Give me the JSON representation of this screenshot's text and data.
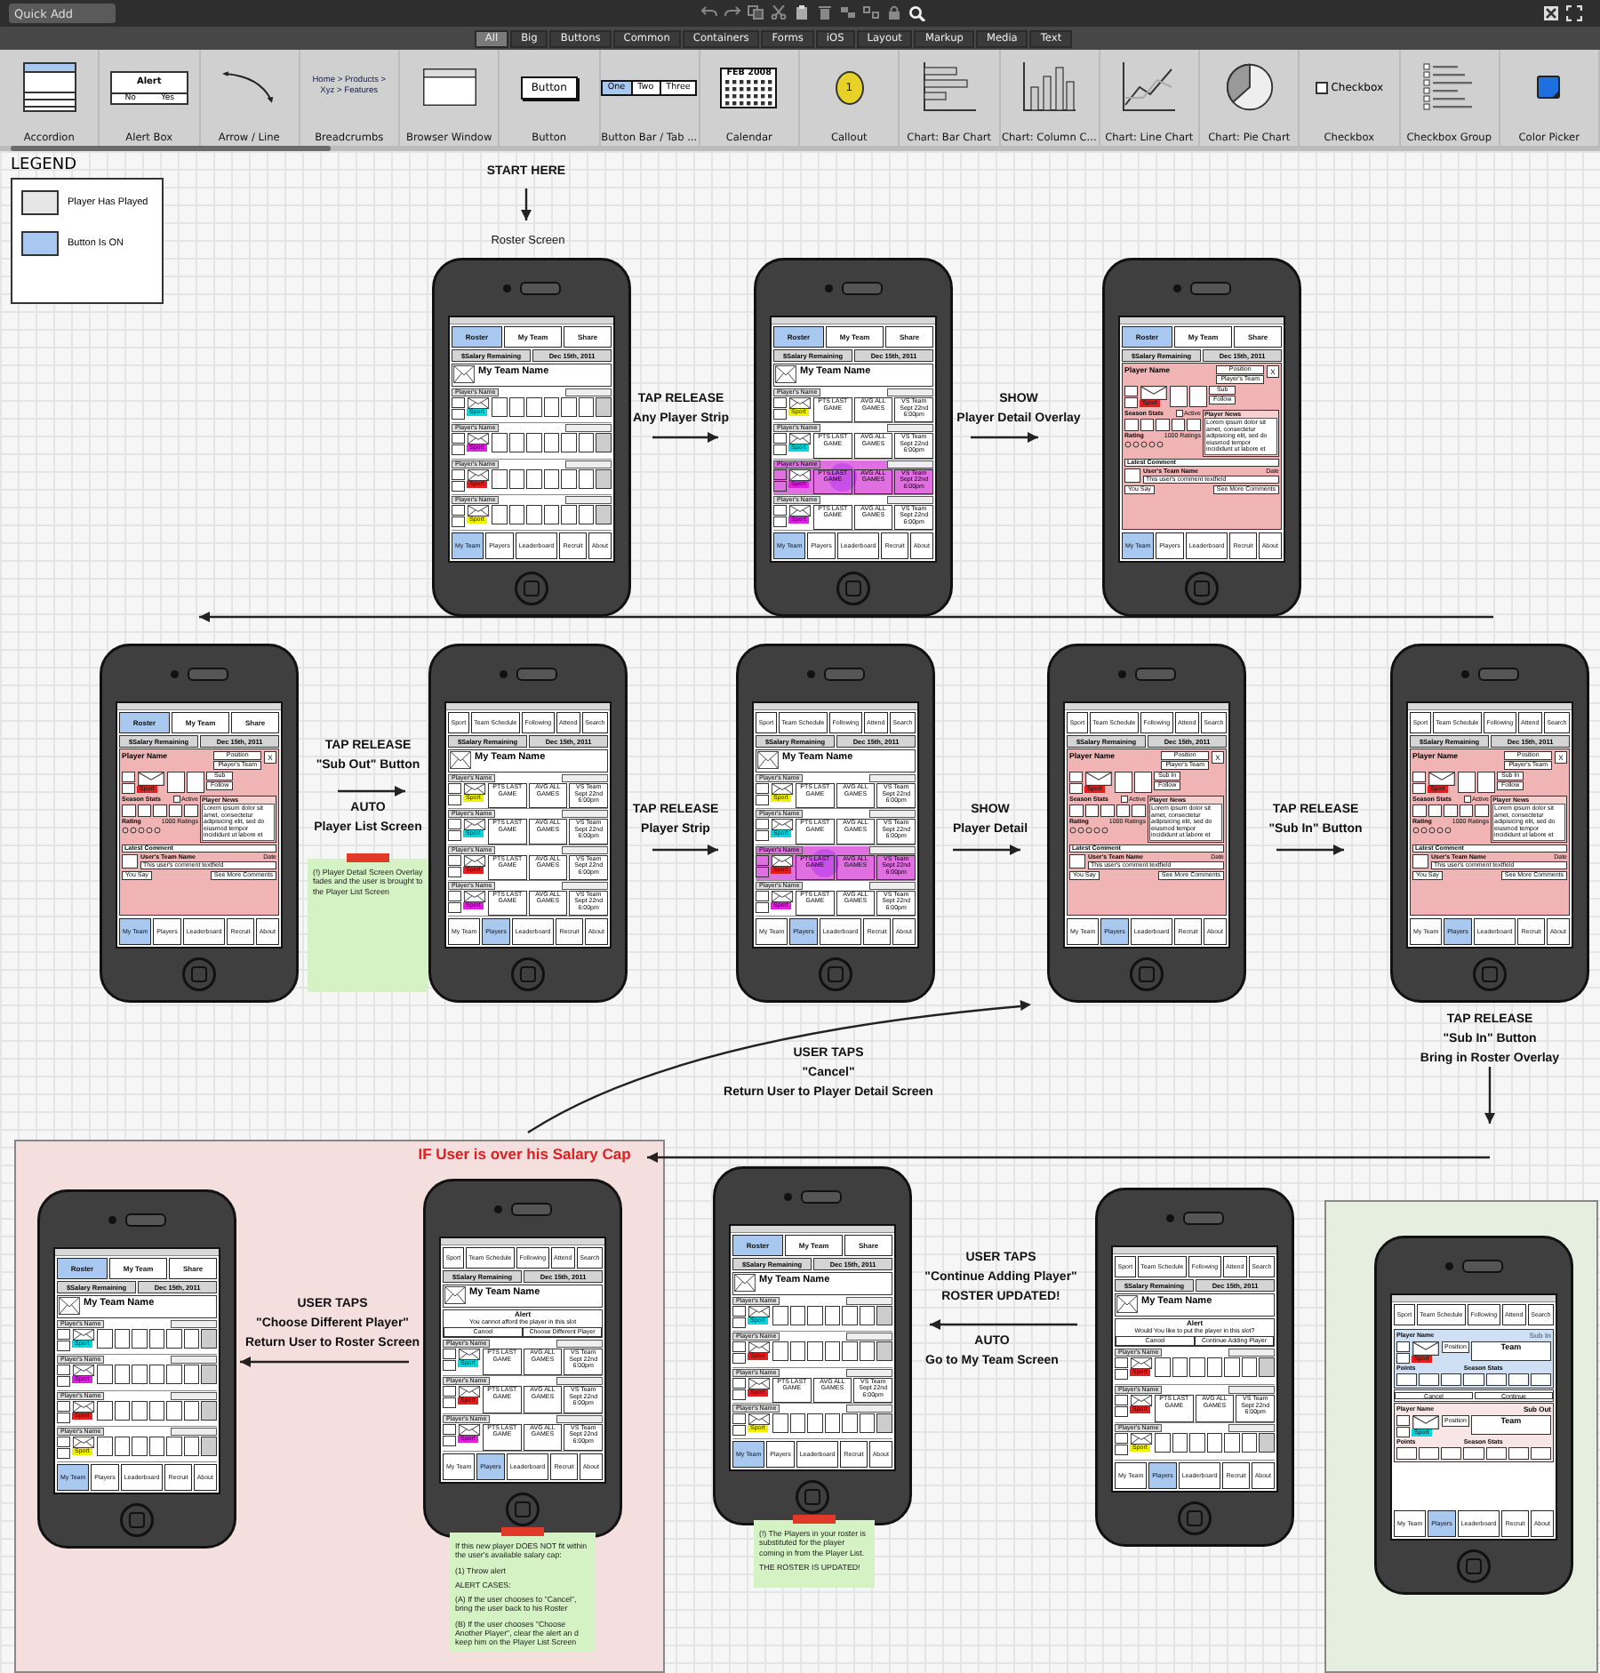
{
  "toolbar": {
    "quick_add": {
      "placeholder": "Quick Add"
    },
    "filters": [
      {
        "label": "All",
        "selected": true
      },
      {
        "label": "Big",
        "selected": false
      },
      {
        "label": "Buttons",
        "selected": false
      },
      {
        "label": "Common",
        "selected": false
      },
      {
        "label": "Containers",
        "selected": false
      },
      {
        "label": "Forms",
        "selected": false
      },
      {
        "label": "iOS",
        "selected": false
      },
      {
        "label": "Layout",
        "selected": false
      },
      {
        "label": "Markup",
        "selected": false
      },
      {
        "label": "Media",
        "selected": false
      },
      {
        "label": "Text",
        "selected": false
      }
    ],
    "components": [
      {
        "kind": "accordion",
        "label": "Accordion"
      },
      {
        "kind": "alertbox",
        "label": "Alert Box",
        "preview": [
          "Alert",
          "No",
          "Yes"
        ]
      },
      {
        "kind": "arrow",
        "label": "Arrow / Line"
      },
      {
        "kind": "breadcrumbs",
        "label": "Breadcrumbs",
        "preview": [
          "Home > Products > Xyz > Features"
        ]
      },
      {
        "kind": "browser",
        "label": "Browser Window"
      },
      {
        "kind": "button",
        "label": "Button",
        "preview": [
          "Button"
        ]
      },
      {
        "kind": "buttonbar",
        "label": "Button Bar / Tab ...",
        "preview": [
          "One",
          "Two",
          "Three"
        ]
      },
      {
        "kind": "calendar",
        "label": "Calendar",
        "preview": [
          "FEB 2008"
        ]
      },
      {
        "kind": "callout",
        "label": "Callout",
        "preview": [
          "1"
        ]
      },
      {
        "kind": "barchart",
        "label": "Chart: Bar Chart"
      },
      {
        "kind": "columnchart",
        "label": "Chart: Column C..."
      },
      {
        "kind": "linechart",
        "label": "Chart: Line Chart"
      },
      {
        "kind": "piechart",
        "label": "Chart: Pie Chart"
      },
      {
        "kind": "checkbox",
        "label": "Checkbox",
        "preview": [
          "Checkbox"
        ]
      },
      {
        "kind": "checkboxgroup",
        "label": "Checkbox Group"
      },
      {
        "kind": "colorpicker",
        "label": "Color Picker"
      }
    ]
  },
  "legend": {
    "title": "LEGEND",
    "items": [
      {
        "label": "Player Has Played",
        "color": "#e6e6e6"
      },
      {
        "label": "Button Is ON",
        "color": "#a8c8f0"
      }
    ]
  },
  "annotations": [
    {
      "kind": "plain",
      "lines": [
        "START HERE"
      ]
    },
    {
      "kind": "small",
      "lines": [
        "Roster Screen"
      ]
    },
    {
      "kind": "plain",
      "lines": [
        "TAP RELEASE",
        "Any Player Strip"
      ]
    },
    {
      "kind": "plain",
      "lines": [
        "SHOW",
        "Player Detail Overlay"
      ]
    },
    {
      "kind": "plain",
      "lines": [
        "TAP RELEASE",
        "\"Sub Out\" Button"
      ]
    },
    {
      "kind": "plain",
      "lines": [
        "AUTO",
        "Player List Screen"
      ]
    },
    {
      "kind": "plain",
      "lines": [
        "TAP RELEASE",
        "Player Strip"
      ]
    },
    {
      "kind": "plain",
      "lines": [
        "SHOW",
        "Player Detail"
      ]
    },
    {
      "kind": "plain",
      "lines": [
        "TAP RELEASE",
        "\"Sub In\" Button"
      ]
    },
    {
      "kind": "plain",
      "lines": [
        "TAP RELEASE",
        "\"Sub In\" Button",
        "Bring in Roster Overlay"
      ]
    },
    {
      "kind": "plain",
      "lines": [
        "USER TAPS",
        "\"Cancel\"",
        "Return User to Player Detail Screen"
      ]
    },
    {
      "kind": "warning",
      "lines": [
        "IF User is over his Salary Cap"
      ]
    },
    {
      "kind": "plain",
      "lines": [
        "USER TAPS",
        "\"Choose Different Player\"",
        "Return User to Roster Screen"
      ]
    },
    {
      "kind": "plain",
      "lines": [
        "USER TAPS",
        "\"Continue Adding Player\"",
        "ROSTER UPDATED!"
      ]
    },
    {
      "kind": "plain",
      "lines": [
        "AUTO",
        "Go to My Team Screen"
      ]
    }
  ],
  "phones": [
    {
      "kind": "roster",
      "top_tabs": [
        {
          "label": "Roster",
          "selected": true
        },
        {
          "label": "My Team",
          "selected": false
        },
        {
          "label": "Share",
          "selected": false
        }
      ],
      "salary": "$Salary Remaining",
      "date": "Dec 15th, 2011",
      "team_name": "My Team Name",
      "strips": [
        {
          "name": "Player's Name",
          "tag": "Sport",
          "color": "#00d8e0",
          "selected": false
        },
        {
          "name": "Player's Name",
          "tag": "Sport",
          "color": "#e020e0",
          "selected": false
        },
        {
          "name": "Player's Name",
          "tag": "Sport",
          "color": "#e02020",
          "selected": false
        },
        {
          "name": "Player's Name",
          "tag": "Sport",
          "color": "#f0f000",
          "selected": false
        }
      ],
      "bottom_tabs": [
        {
          "label": "My Team",
          "selected": true
        },
        {
          "label": "Players",
          "selected": false
        },
        {
          "label": "Leaderboard",
          "selected": false
        },
        {
          "label": "Recruit",
          "selected": false
        },
        {
          "label": "About",
          "selected": false
        }
      ]
    },
    {
      "kind": "roster",
      "top_tabs": [
        {
          "label": "Roster",
          "selected": true
        },
        {
          "label": "My Team",
          "selected": false
        },
        {
          "label": "Share",
          "selected": false
        }
      ],
      "salary": "$Salary Remaining",
      "date": "Dec 15th, 2011",
      "team_name": "My Team Name",
      "strips": [
        {
          "name": "Player's Name",
          "tag": "Sport",
          "color": "#f0f000",
          "selected": false,
          "stats": [
            "PTS LAST GAME",
            "AVG ALL GAMES",
            "VS Team Sept 22nd 6:00pm"
          ]
        },
        {
          "name": "Player's Name",
          "tag": "Sport",
          "color": "#00d8e0",
          "selected": false,
          "stats": [
            "PTS LAST GAME",
            "AVG ALL GAMES",
            "VS Team Sept 22nd 6:00pm"
          ]
        },
        {
          "name": "Player's Name",
          "tag": "Sport",
          "color": "#e020e0",
          "selected": true,
          "stats": [
            "PTS LAST GAME",
            "AVG ALL GAMES",
            "VS Team Sept 22nd 6:00pm"
          ]
        },
        {
          "name": "Player's Name",
          "tag": "Sport",
          "color": "#e020e0",
          "selected": false,
          "stats": [
            "PTS LAST GAME",
            "AVG ALL GAMES",
            "VS Team Sept 22nd 6:00pm"
          ]
        }
      ],
      "bottom_tabs": [
        {
          "label": "My Team",
          "selected": true
        },
        {
          "label": "Players",
          "selected": false
        },
        {
          "label": "Leaderboard",
          "selected": false
        },
        {
          "label": "Recruit",
          "selected": false
        },
        {
          "label": "About",
          "selected": false
        }
      ]
    },
    {
      "kind": "detail",
      "top_tabs": [
        {
          "label": "Roster",
          "selected": true
        },
        {
          "label": "My Team",
          "selected": false
        },
        {
          "label": "Share",
          "selected": false
        }
      ],
      "salary": "$Salary Remaining",
      "date": "Dec 15th, 2011",
      "detail": {
        "player_name": "Player Name",
        "position": "Position",
        "team": "Player's Team",
        "close": "X",
        "tag": "Sport",
        "action": "Sub",
        "follow": "Follow",
        "season_stats": "Season Stats",
        "active": "Active",
        "active_checked": false,
        "news_title": "Player News",
        "news": "Lorem ipsum dolor sit amet, consectetur adipisicing elit, sed do eiusmod tempor incididunt ut labore et",
        "rating": "Rating",
        "ratings_count": "1000 Ratings",
        "comment_title": "Latest Comment",
        "comment_user": "User's Team Name",
        "comment_date": "Date",
        "comment": "This user's comment textfield",
        "you_say": "You Say",
        "more": "See More Comments"
      },
      "bottom_tabs": [
        {
          "label": "My Team",
          "selected": true
        },
        {
          "label": "Players",
          "selected": false
        },
        {
          "label": "Leaderboard",
          "selected": false
        },
        {
          "label": "Recruit",
          "selected": false
        },
        {
          "label": "About",
          "selected": false
        }
      ]
    },
    {
      "kind": "detail",
      "top_tabs": [
        {
          "label": "Roster",
          "selected": true
        },
        {
          "label": "My Team",
          "selected": false
        },
        {
          "label": "Share",
          "selected": false
        }
      ],
      "salary": "$Salary Remaining",
      "date": "Dec 15th, 2011",
      "detail": {
        "player_name": "Player Name",
        "position": "Position",
        "team": "Player's Team",
        "close": "X",
        "tag": "Sport",
        "action": "Sub",
        "follow": "Follow",
        "season_stats": "Season Stats",
        "active": "Active",
        "active_checked": false,
        "news_title": "Player News",
        "news": "Lorem ipsum dolor sit amet, consectetur adipisicing elit, sed do eiusmod tempor incididunt ut labore et",
        "rating": "Rating",
        "ratings_count": "1000 Ratings",
        "comment_title": "Latest Comment",
        "comment_user": "User's Team Name",
        "comment_date": "Date",
        "comment": "This user's comment textfield",
        "you_say": "You Say",
        "more": "See More Comments"
      },
      "bottom_tabs": [
        {
          "label": "My Team",
          "selected": true
        },
        {
          "label": "Players",
          "selected": false
        },
        {
          "label": "Leaderboard",
          "selected": false
        },
        {
          "label": "Recruit",
          "selected": false
        },
        {
          "label": "About",
          "selected": false
        }
      ]
    },
    {
      "kind": "roster",
      "top_tabs": [
        {
          "label": "Sport",
          "selected": false
        },
        {
          "label": "Team Schedule",
          "selected": false
        },
        {
          "label": "Following",
          "selected": false
        },
        {
          "label": "Attend",
          "selected": false
        },
        {
          "label": "Search",
          "selected": false
        }
      ],
      "salary": "$Salary Remaining",
      "date": "Dec 15th, 2011",
      "team_name": "My Team Name",
      "strips": [
        {
          "name": "Player's Name",
          "tag": "Sport",
          "color": "#f0f000",
          "selected": false,
          "stats": [
            "PTS LAST GAME",
            "AVG ALL GAMES",
            "VS Team Sept 22nd 6:00pm"
          ]
        },
        {
          "name": "Player's Name",
          "tag": "Sport",
          "color": "#00d8e0",
          "selected": false,
          "stats": [
            "PTS LAST GAME",
            "AVG ALL GAMES",
            "VS Team Sept 22nd 6:00pm"
          ]
        },
        {
          "name": "Player's Name",
          "tag": "Sport",
          "color": "#e02020",
          "selected": false,
          "stats": [
            "PTS LAST GAME",
            "AVG ALL GAMES",
            "VS Team Sept 22nd 6:00pm"
          ]
        },
        {
          "name": "Player's Name",
          "tag": "Sport",
          "color": "#e020e0",
          "selected": false,
          "stats": [
            "PTS LAST GAME",
            "AVG ALL GAMES",
            "VS Team Sept 22nd 6:00pm"
          ]
        }
      ],
      "bottom_tabs": [
        {
          "label": "My Team",
          "selected": false
        },
        {
          "label": "Players",
          "selected": true
        },
        {
          "label": "Leaderboard",
          "selected": false
        },
        {
          "label": "Recruit",
          "selected": false
        },
        {
          "label": "About",
          "selected": false
        }
      ]
    },
    {
      "kind": "roster",
      "top_tabs": [
        {
          "label": "Sport",
          "selected": false
        },
        {
          "label": "Team Schedule",
          "selected": false
        },
        {
          "label": "Following",
          "selected": false
        },
        {
          "label": "Attend",
          "selected": false
        },
        {
          "label": "Search",
          "selected": false
        }
      ],
      "salary": "$Salary Remaining",
      "date": "Dec 15th, 2011",
      "team_name": "My Team Name",
      "strips": [
        {
          "name": "Player's Name",
          "tag": "Sport",
          "color": "#f0f000",
          "selected": false,
          "stats": [
            "PTS LAST GAME",
            "AVG ALL GAMES",
            "VS Team Sept 22nd 6:00pm"
          ]
        },
        {
          "name": "Player's Name",
          "tag": "Sport",
          "color": "#00d8e0",
          "selected": false,
          "stats": [
            "PTS LAST GAME",
            "AVG ALL GAMES",
            "VS Team Sept 22nd 6:00pm"
          ]
        },
        {
          "name": "Player's Name",
          "tag": "Sport",
          "color": "#e02020",
          "selected": true,
          "stats": [
            "PTS LAST GAME",
            "AVG ALL GAMES",
            "VS Team Sept 22nd 6:00pm"
          ]
        },
        {
          "name": "Player's Name",
          "tag": "Sport",
          "color": "#e020e0",
          "selected": false,
          "stats": [
            "PTS LAST GAME",
            "AVG ALL GAMES",
            "VS Team Sept 22nd 6:00pm"
          ]
        }
      ],
      "bottom_tabs": [
        {
          "label": "My Team",
          "selected": false
        },
        {
          "label": "Players",
          "selected": true
        },
        {
          "label": "Leaderboard",
          "selected": false
        },
        {
          "label": "Recruit",
          "selected": false
        },
        {
          "label": "About",
          "selected": false
        }
      ]
    },
    {
      "kind": "detail",
      "top_tabs": [
        {
          "label": "Sport",
          "selected": false
        },
        {
          "label": "Team Schedule",
          "selected": false
        },
        {
          "label": "Following",
          "selected": false
        },
        {
          "label": "Attend",
          "selected": false
        },
        {
          "label": "Search",
          "selected": false
        }
      ],
      "salary": "$Salary Remaining",
      "date": "Dec 15th, 2011",
      "detail": {
        "player_name": "Player Name",
        "position": "Position",
        "team": "Player's Team",
        "close": "X",
        "tag": "Sport",
        "action": "Sub In",
        "follow": "Follow",
        "season_stats": "Season Stats",
        "active": "Active",
        "active_checked": false,
        "news_title": "Player News",
        "news": "Lorem ipsum dolor sit amet, consectetur adipisicing elit, sed do eiusmod tempor incididunt ut labore et",
        "rating": "Rating",
        "ratings_count": "1000 Ratings",
        "comment_title": "Latest Comment",
        "comment_user": "User's Team Name",
        "comment_date": "Date",
        "comment": "This user's comment textfield",
        "you_say": "You Say",
        "more": "See More Comments"
      },
      "bottom_tabs": [
        {
          "label": "My Team",
          "selected": false
        },
        {
          "label": "Players",
          "selected": true
        },
        {
          "label": "Leaderboard",
          "selected": false
        },
        {
          "label": "Recruit",
          "selected": false
        },
        {
          "label": "About",
          "selected": false
        }
      ]
    },
    {
      "kind": "detail",
      "top_tabs": [
        {
          "label": "Sport",
          "selected": false
        },
        {
          "label": "Team Schedule",
          "selected": false
        },
        {
          "label": "Following",
          "selected": false
        },
        {
          "label": "Attend",
          "selected": false
        },
        {
          "label": "Search",
          "selected": false
        }
      ],
      "salary": "$Salary Remaining",
      "date": "Dec 15th, 2011",
      "detail": {
        "player_name": "Player Name",
        "position": "Position",
        "team": "Player's Team",
        "close": "X",
        "tag": "Sport",
        "action": "Sub In",
        "follow": "Follow",
        "season_stats": "Season Stats",
        "active": "Active",
        "active_checked": false,
        "news_title": "Player News",
        "news": "Lorem ipsum dolor sit amet, consectetur adipisicing elit, sed do eiusmod tempor incididunt ut labore et",
        "rating": "Rating",
        "ratings_count": "1000 Ratings",
        "comment_title": "Latest Comment",
        "comment_user": "User's Team Name",
        "comment_date": "Date",
        "comment": "This user's comment textfield",
        "you_say": "You Say",
        "more": "See More Comments"
      },
      "bottom_tabs": [
        {
          "label": "My Team",
          "selected": false
        },
        {
          "label": "Players",
          "selected": true
        },
        {
          "label": "Leaderboard",
          "selected": false
        },
        {
          "label": "Recruit",
          "selected": false
        },
        {
          "label": "About",
          "selected": false
        }
      ]
    },
    {
      "kind": "roster",
      "top_tabs": [
        {
          "label": "Roster",
          "selected": true
        },
        {
          "label": "My Team",
          "selected": false
        },
        {
          "label": "Share",
          "selected": false
        }
      ],
      "salary": "$Salary Remaining",
      "date": "Dec 15th, 2011",
      "team_name": "My Team Name",
      "strips": [
        {
          "name": "Player's Name",
          "tag": "Sport",
          "color": "#00d8e0",
          "selected": false
        },
        {
          "name": "Player's Name",
          "tag": "Sport",
          "color": "#e020e0",
          "selected": false
        },
        {
          "name": "Player's Name",
          "tag": "Sport",
          "color": "#e02020",
          "selected": false
        },
        {
          "name": "Player's Name",
          "tag": "Sport",
          "color": "#f0f000",
          "selected": false
        }
      ],
      "bottom_tabs": [
        {
          "label": "My Team",
          "selected": true
        },
        {
          "label": "Players",
          "selected": false
        },
        {
          "label": "Leaderboard",
          "selected": false
        },
        {
          "label": "Recruit",
          "selected": false
        },
        {
          "label": "About",
          "selected": false
        }
      ]
    },
    {
      "kind": "alert",
      "top_tabs": [
        {
          "label": "Sport",
          "selected": false
        },
        {
          "label": "Team Schedule",
          "selected": false
        },
        {
          "label": "Following",
          "selected": false
        },
        {
          "label": "Attend",
          "selected": false
        },
        {
          "label": "Search",
          "selected": false
        }
      ],
      "salary": "$Salary Remaining",
      "date": "Dec 15th, 2011",
      "team_name": "My Team Name",
      "alert": {
        "title": "Alert",
        "message": "You cannot afford the player in this slot",
        "buttons": [
          "Cancel",
          "Choose Different Player"
        ]
      },
      "strips": [
        {
          "name": "Player's Name",
          "tag": "Sport",
          "color": "#00d8e0",
          "selected": false,
          "stats": [
            "PTS LAST GAME",
            "AVG ALL GAMES",
            "VS Team Sept 22nd 6:00pm"
          ]
        },
        {
          "name": "Player's Name",
          "tag": "Sport",
          "color": "#e02020",
          "selected": false,
          "stats": [
            "PTS LAST GAME",
            "AVG ALL GAMES",
            "VS Team Sept 22nd 6:00pm"
          ]
        },
        {
          "name": "Player's Name",
          "tag": "Sport",
          "color": "#e020e0",
          "selected": false,
          "stats": [
            "PTS LAST GAME",
            "AVG ALL GAMES",
            "VS Team Sept 22nd 6:00pm"
          ]
        }
      ],
      "bottom_tabs": [
        {
          "label": "My Team",
          "selected": false
        },
        {
          "label": "Players",
          "selected": true
        },
        {
          "label": "Leaderboard",
          "selected": false
        },
        {
          "label": "Recruit",
          "selected": false
        },
        {
          "label": "About",
          "selected": false
        }
      ]
    },
    {
      "kind": "roster",
      "top_tabs": [
        {
          "label": "Roster",
          "selected": true
        },
        {
          "label": "My Team",
          "selected": false
        },
        {
          "label": "Share",
          "selected": false
        }
      ],
      "salary": "$Salary Remaining",
      "date": "Dec 15th, 2011",
      "team_name": "My Team Name",
      "strips": [
        {
          "name": "Player's Name",
          "tag": "Sport",
          "color": "#00d8e0",
          "selected": false
        },
        {
          "name": "Player's Name",
          "tag": "Sport",
          "color": "#e02020",
          "selected": false
        },
        {
          "name": "Player's Name",
          "tag": "Sport",
          "color": "#e02020",
          "selected": false,
          "stats": [
            "PTS LAST GAME",
            "AVG ALL GAMES",
            "VS Team Sept 22nd 6:00pm"
          ]
        },
        {
          "name": "Player's Name",
          "tag": "Sport",
          "color": "#f0f000",
          "selected": false
        }
      ],
      "bottom_tabs": [
        {
          "label": "My Team",
          "selected": true
        },
        {
          "label": "Players",
          "selected": false
        },
        {
          "label": "Leaderboard",
          "selected": false
        },
        {
          "label": "Recruit",
          "selected": false
        },
        {
          "label": "About",
          "selected": false
        }
      ]
    },
    {
      "kind": "alert",
      "top_tabs": [
        {
          "label": "Sport",
          "selected": false
        },
        {
          "label": "Team Schedule",
          "selected": false
        },
        {
          "label": "Following",
          "selected": false
        },
        {
          "label": "Attend",
          "selected": false
        },
        {
          "label": "Search",
          "selected": false
        }
      ],
      "salary": "$Salary Remaining",
      "date": "Dec 15th, 2011",
      "team_name": "My Team Name",
      "alert": {
        "title": "Alert",
        "message": "Would You like to put the player in this slot?",
        "buttons": [
          "Cancel",
          "Continue Adding Player"
        ]
      },
      "strips": [
        {
          "name": "Player's Name",
          "tag": "Sport",
          "color": "#e02020",
          "selected": false
        },
        {
          "name": "Player's Name",
          "tag": "Sport",
          "color": "#e02020",
          "selected": false,
          "stats": [
            "PTS LAST GAME",
            "AVG ALL GAMES",
            "VS Team Sept 22nd 6:00pm"
          ]
        },
        {
          "name": "Player's Name",
          "tag": "Sport",
          "color": "#f0f000",
          "selected": false
        }
      ],
      "bottom_tabs": [
        {
          "label": "My Team",
          "selected": false
        },
        {
          "label": "Players",
          "selected": true
        },
        {
          "label": "Leaderboard",
          "selected": false
        },
        {
          "label": "Recruit",
          "selected": false
        },
        {
          "label": "About",
          "selected": false
        }
      ]
    },
    {
      "kind": "swap",
      "top_tabs": [
        {
          "label": "Sport",
          "selected": false
        },
        {
          "label": "Team Schedule",
          "selected": false
        },
        {
          "label": "Following",
          "selected": false
        },
        {
          "label": "Attend",
          "selected": false
        },
        {
          "label": "Search",
          "selected": false
        }
      ],
      "swap": {
        "panels": [
          {
            "kind": "in",
            "name": "Player Name",
            "action": "Sub In",
            "position": "Position",
            "team": "Team",
            "points": "Points",
            "stats": "Season Stats",
            "tag": "Sport",
            "color": "#e02020"
          },
          {
            "kind": "out",
            "name": "Player Name",
            "action": "Sub Out",
            "position": "Position",
            "team": "Team",
            "points": "Points",
            "stats": "Season Stats",
            "tag": "Sport",
            "color": "#00d8e0"
          }
        ],
        "buttons": [
          "Cancel",
          "Continue"
        ]
      },
      "bottom_tabs": [
        {
          "label": "My Team",
          "selected": false
        },
        {
          "label": "Players",
          "selected": true
        },
        {
          "label": "Leaderboard",
          "selected": false
        },
        {
          "label": "Recruit",
          "selected": false
        },
        {
          "label": "About",
          "selected": false
        }
      ]
    }
  ],
  "notes": [
    {
      "paragraphs": [
        "(!) Player Detail Screen Overlay fades and the user is brought to the Player List Screen"
      ]
    },
    {
      "paragraphs": [
        "If this new player DOES NOT fit within the user's available salary cap:",
        "(1) Throw alert",
        "ALERT CASES:",
        "(A) If the user chooses to \"Cancel\", bring the user back to his Roster",
        "(B) If the user chooses \"Choose Another Player\", clear the alert an d keep him on the Player List Screen"
      ]
    },
    {
      "paragraphs": [
        "(!) The Players in your roster is substituted  for the player coming in from the Player List.",
        "THE ROSTER IS UPDATED!"
      ]
    }
  ]
}
